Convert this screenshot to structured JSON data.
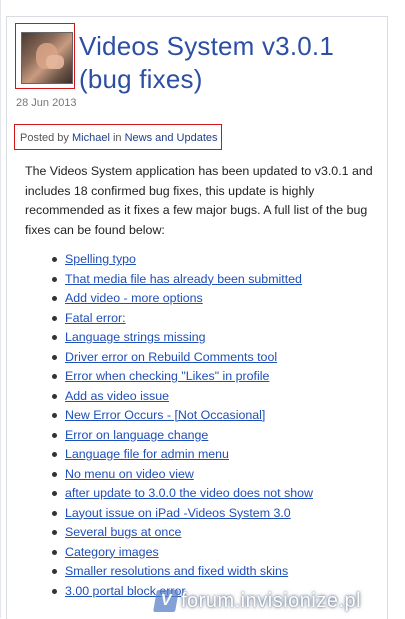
{
  "post": {
    "title": "Videos System v3.0.1 (bug fixes)",
    "date": "28 Jun 2013",
    "posted_by_prefix": "Posted by",
    "author": "Michael",
    "in_word": "in",
    "category": "News and Updates",
    "body": "The Videos System application has been updated to v3.0.1 and includes 18 confirmed bug fixes, this update is highly recommended as it fixes a few major bugs. A full list of the bug fixes can be found below:",
    "bug_list": [
      "Spelling typo",
      "That media file has already been submitted",
      "Add video - more options",
      "Fatal error:",
      "Language strings missing",
      "Driver error on Rebuild Comments tool",
      "Error when checking \"Likes\" in profile",
      "Add as video issue",
      "New Error Occurs - [Not Occasional]",
      "Error on language change",
      "Language file for admin menu",
      "No menu on video view",
      "after update to 3.0.0 the video does not show",
      "Layout issue on iPad -Videos System 3.0",
      "Several bugs at once",
      "Category images",
      "Smaller resolutions and fixed width skins",
      "3.00 portal block error"
    ]
  },
  "watermark": {
    "text": "forum.invisionize.pl",
    "badge": "V"
  },
  "colors": {
    "highlight_border": "#d2141b",
    "title": "#2c4fa3",
    "link": "#1f4fb8"
  }
}
